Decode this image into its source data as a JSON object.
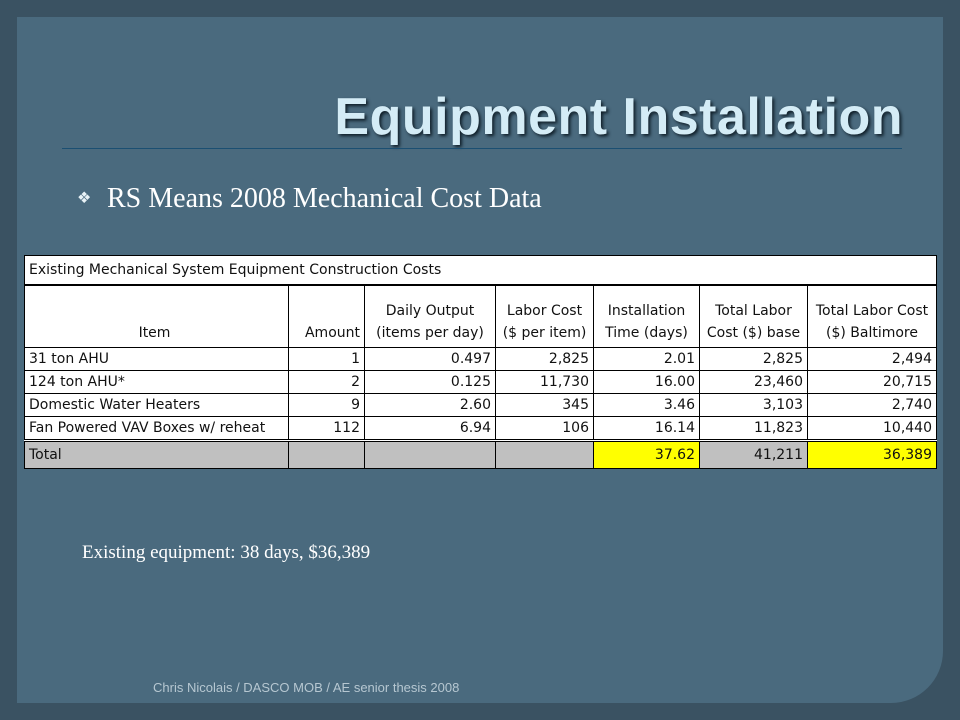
{
  "slide": {
    "title": "Equipment Installation",
    "bullet_text": "RS Means 2008 Mechanical Cost Data",
    "summary": "Existing equipment: 38 days, $36,389",
    "footer": "Chris Nicolais / DASCO MOB / AE senior thesis 2008"
  },
  "table": {
    "caption": "Existing Mechanical System Equipment Construction Costs",
    "headers": [
      [
        "",
        "Item"
      ],
      [
        "",
        "Amount"
      ],
      [
        "Daily Output",
        "(items per day)"
      ],
      [
        "Labor Cost",
        "($ per item)"
      ],
      [
        "Installation",
        "Time (days)"
      ],
      [
        "Total Labor",
        "Cost ($) base"
      ],
      [
        "Total Labor Cost",
        "($) Baltimore"
      ]
    ],
    "rows": [
      [
        "31 ton AHU",
        "1",
        "0.497",
        "2,825",
        "2.01",
        "2,825",
        "2,494"
      ],
      [
        "124 ton AHU*",
        "2",
        "0.125",
        "11,730",
        "16.00",
        "23,460",
        "20,715"
      ],
      [
        "Domestic Water Heaters",
        "9",
        "2.60",
        "345",
        "3.46",
        "3,103",
        "2,740"
      ],
      [
        "Fan Powered VAV Boxes w/ reheat",
        "112",
        "6.94",
        "106",
        "16.14",
        "11,823",
        "10,440"
      ]
    ],
    "total": {
      "label": "Total",
      "installation_days": "37.62",
      "total_base": "41,211",
      "total_baltimore": "36,389"
    },
    "colors": {
      "highlight": "#ffff00",
      "shaded": "#c0c0c0"
    }
  },
  "theme": {
    "background": "#3a5262",
    "slide_fill": "#4a6a7e",
    "title_color": "#d4ecf6"
  }
}
